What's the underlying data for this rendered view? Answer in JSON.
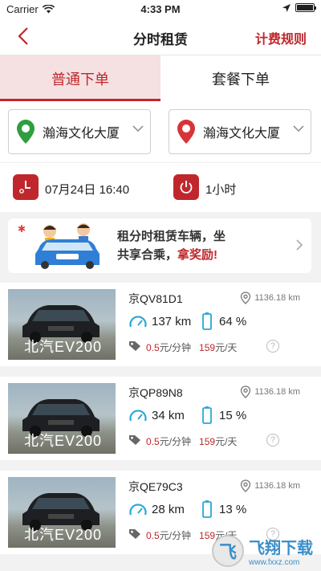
{
  "status_bar": {
    "carrier": "Carrier",
    "time": "4:33 PM"
  },
  "nav": {
    "title": "分时租赁",
    "rules_link": "计费规则"
  },
  "tabs": [
    {
      "label": "普通下单",
      "active": true
    },
    {
      "label": "套餐下单",
      "active": false
    }
  ],
  "locations": {
    "pickup": "瀚海文化大厦",
    "return": "瀚海文化大厦"
  },
  "schedule": {
    "start_time": "07月24日 16:40",
    "duration": "1小时"
  },
  "promo": {
    "text_line1": "租分时租赁车辆，坐",
    "text_line2": "共享合乘，",
    "highlight": "拿奖励!"
  },
  "vehicles": [
    {
      "image_label": "北汽EV200",
      "plate": "京QV81D1",
      "distance": "1136.18 km",
      "range": "137 km",
      "battery": "64 %",
      "price_min": "0.5",
      "price_min_unit": "元/分钟",
      "price_day": "159",
      "price_day_unit": "元/天"
    },
    {
      "image_label": "北汽EV200",
      "plate": "京QP89N8",
      "distance": "1136.18 km",
      "range": "34 km",
      "battery": "15 %",
      "price_min": "0.5",
      "price_min_unit": "元/分钟",
      "price_day": "159",
      "price_day_unit": "元/天"
    },
    {
      "image_label": "北汽EV200",
      "plate": "京QE79C3",
      "distance": "1136.18 km",
      "range": "28 km",
      "battery": "13 %",
      "price_min": "0.5",
      "price_min_unit": "元/分钟",
      "price_day": "159",
      "price_day_unit": "元/天"
    }
  ],
  "watermark": {
    "brand": "飞翔下载",
    "url": "www.fxxz.com"
  },
  "colors": {
    "accent": "#c0272d",
    "pin_green": "#2e9e3e",
    "pin_red": "#d7343a",
    "gauge_blue": "#2aa7d8"
  }
}
